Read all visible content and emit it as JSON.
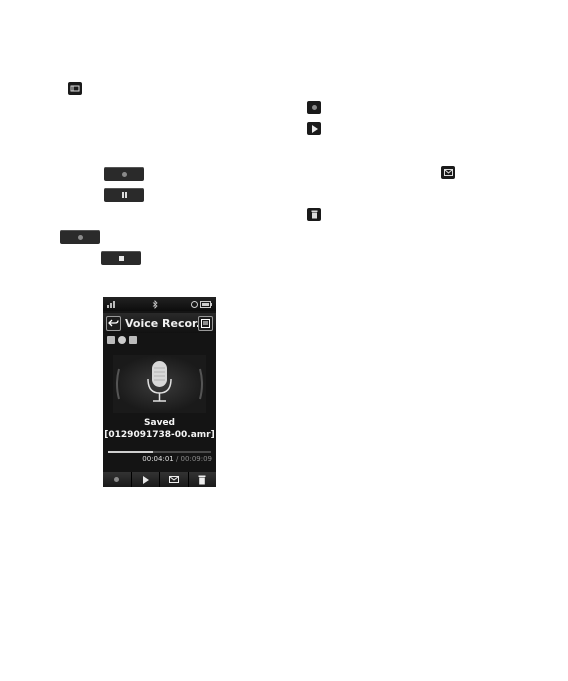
{
  "phone": {
    "title": "Voice Recor...",
    "saved_label": "Saved",
    "saved_file": "[0129091738-00.amr]",
    "time_elapsed": "00:04:01",
    "time_separator": " / ",
    "time_total": "00:09:09",
    "progress_fraction": 0.44
  },
  "icons": {
    "settings": "menu-icon",
    "record": "record-icon",
    "pause": "pause-icon",
    "stop": "stop-icon",
    "play": "play-icon",
    "message": "envelope-icon",
    "delete": "trash-icon"
  }
}
